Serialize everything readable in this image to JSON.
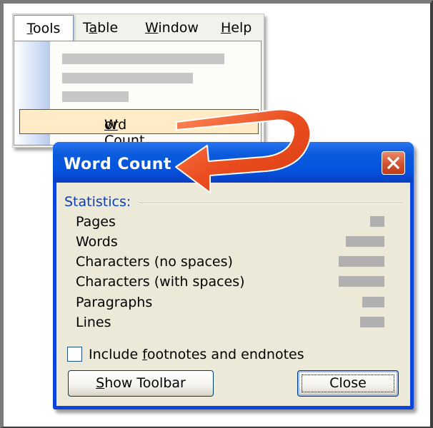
{
  "menubar": {
    "items": [
      {
        "pre": "",
        "key": "T",
        "post": "ools"
      },
      {
        "pre": "T",
        "key": "a",
        "post": "ble"
      },
      {
        "pre": "",
        "key": "W",
        "post": "indow"
      },
      {
        "pre": "",
        "key": "H",
        "post": "elp"
      }
    ]
  },
  "dropdown": {
    "word_count": {
      "pre": "",
      "key": "W",
      "post": "ord Count..."
    }
  },
  "dialog": {
    "title": "Word Count",
    "group_label": "Statistics:",
    "stats": [
      {
        "label": "Pages"
      },
      {
        "label": "Words"
      },
      {
        "label": "Characters (no spaces)"
      },
      {
        "label": "Characters (with spaces)"
      },
      {
        "label": "Paragraphs"
      },
      {
        "label": "Lines"
      }
    ],
    "checkbox": {
      "pre": "Include ",
      "key": "f",
      "post": "ootnotes and endnotes",
      "checked": false
    },
    "buttons": {
      "show_toolbar": {
        "pre": "",
        "key": "S",
        "post": "how Toolbar"
      },
      "close": {
        "label": "Close"
      }
    }
  },
  "colors": {
    "titlebar": "#0a54e0",
    "arrow": "#e8481c",
    "highlight": "#ffebc6",
    "statistics_label": "#0b3fb6"
  }
}
